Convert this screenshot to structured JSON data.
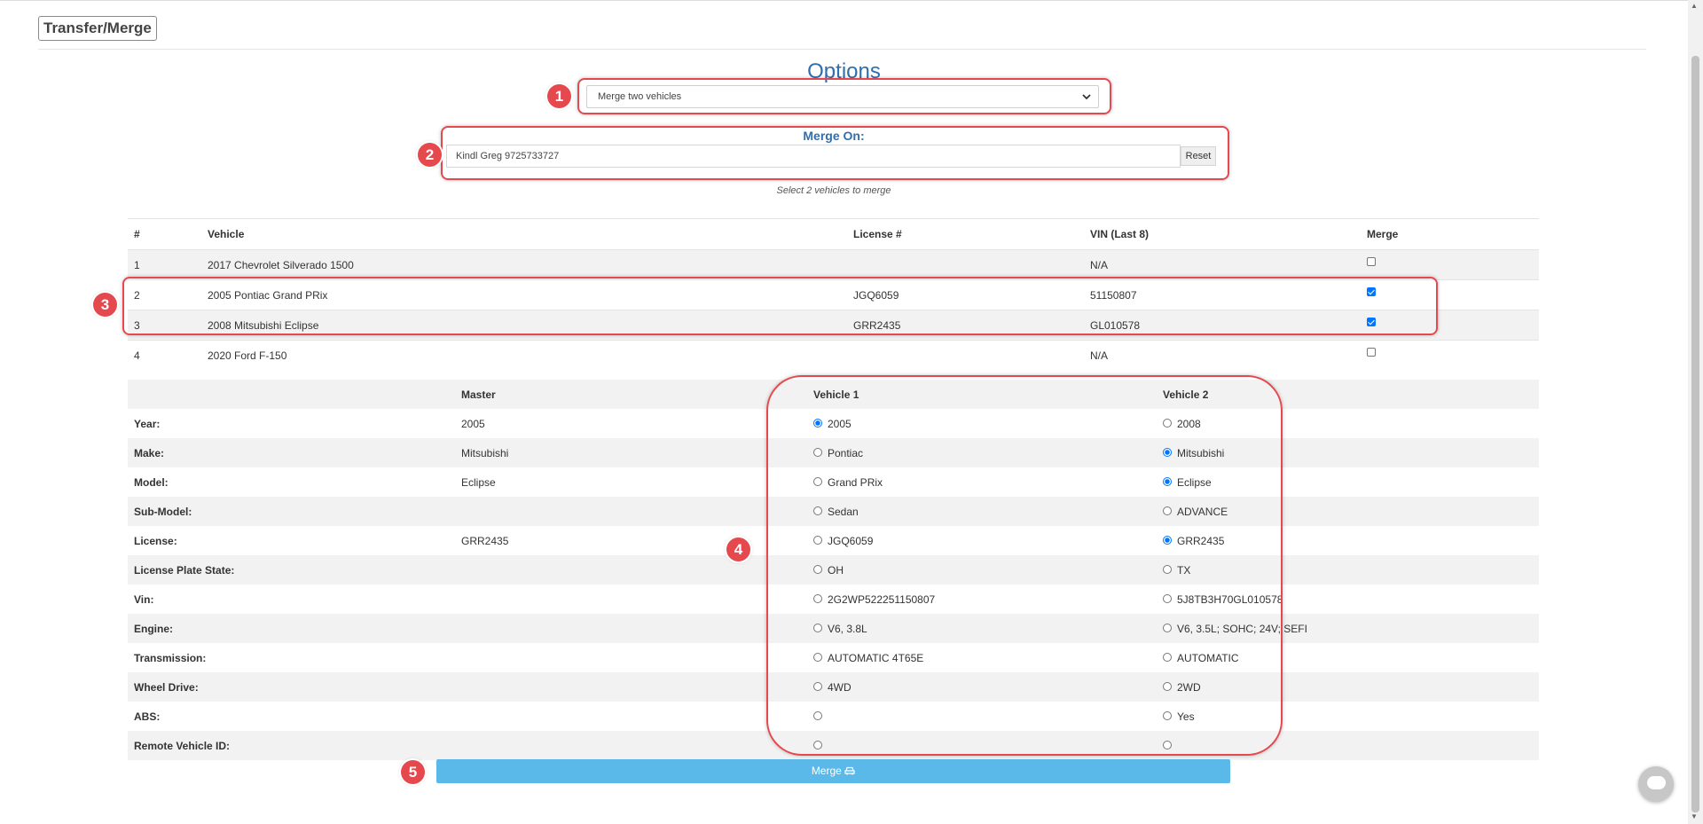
{
  "header": {
    "title": "Transfer/Merge"
  },
  "options": {
    "title": "Options",
    "selected": "Merge two vehicles"
  },
  "merge_on": {
    "label": "Merge On:",
    "value": "Kindl Greg 9725733727",
    "reset_label": "Reset",
    "hint": "Select 2 vehicles to merge"
  },
  "vehicles": {
    "headers": {
      "num": "#",
      "vehicle": "Vehicle",
      "license": "License #",
      "vin": "VIN (Last 8)",
      "merge": "Merge"
    },
    "rows": [
      {
        "num": "1",
        "vehicle": "2017 Chevrolet Silverado 1500",
        "license": "",
        "vin": "N/A",
        "merge": false
      },
      {
        "num": "2",
        "vehicle": "2005 Pontiac Grand PRix",
        "license": "JGQ6059",
        "vin": "51150807",
        "merge": true
      },
      {
        "num": "3",
        "vehicle": "2008 Mitsubishi Eclipse",
        "license": "GRR2435",
        "vin": "GL010578",
        "merge": true
      },
      {
        "num": "4",
        "vehicle": "2020 Ford F-150",
        "license": "",
        "vin": "N/A",
        "merge": false
      }
    ]
  },
  "details": {
    "headers": {
      "field": "",
      "master": "Master",
      "v1": "Vehicle 1",
      "v2": "Vehicle 2"
    },
    "rows": [
      {
        "field": "Year:",
        "master": "2005",
        "v1": "2005",
        "v2": "2008",
        "sel": "v1"
      },
      {
        "field": "Make:",
        "master": "Mitsubishi",
        "v1": "Pontiac",
        "v2": "Mitsubishi",
        "sel": "v2"
      },
      {
        "field": "Model:",
        "master": "Eclipse",
        "v1": "Grand PRix",
        "v2": "Eclipse",
        "sel": "v2"
      },
      {
        "field": "Sub-Model:",
        "master": "",
        "v1": "Sedan",
        "v2": "ADVANCE",
        "sel": ""
      },
      {
        "field": "License:",
        "master": "GRR2435",
        "v1": "JGQ6059",
        "v2": "GRR2435",
        "sel": "v2"
      },
      {
        "field": "License Plate State:",
        "master": "",
        "v1": "OH",
        "v2": "TX",
        "sel": ""
      },
      {
        "field": "Vin:",
        "master": "",
        "v1": "2G2WP522251150807",
        "v2": "5J8TB3H70GL010578",
        "sel": ""
      },
      {
        "field": "Engine:",
        "master": "",
        "v1": "V6, 3.8L",
        "v2": "V6, 3.5L; SOHC; 24V; SEFI",
        "sel": ""
      },
      {
        "field": "Transmission:",
        "master": "",
        "v1": "AUTOMATIC 4T65E",
        "v2": "AUTOMATIC",
        "sel": ""
      },
      {
        "field": "Wheel Drive:",
        "master": "",
        "v1": "4WD",
        "v2": "2WD",
        "sel": ""
      },
      {
        "field": "ABS:",
        "master": "",
        "v1": "",
        "v2": "Yes",
        "sel": ""
      },
      {
        "field": "Remote Vehicle ID:",
        "master": "",
        "v1": "",
        "v2": "",
        "sel": ""
      }
    ]
  },
  "merge_button": {
    "label": "Merge",
    "icon": "car-icon"
  },
  "annotations": [
    "1",
    "2",
    "3",
    "4",
    "5"
  ],
  "colors": {
    "accent": "#2f6fad",
    "annotation": "#e5484d",
    "button": "#5bb9e9",
    "radio": "#0075ff"
  }
}
